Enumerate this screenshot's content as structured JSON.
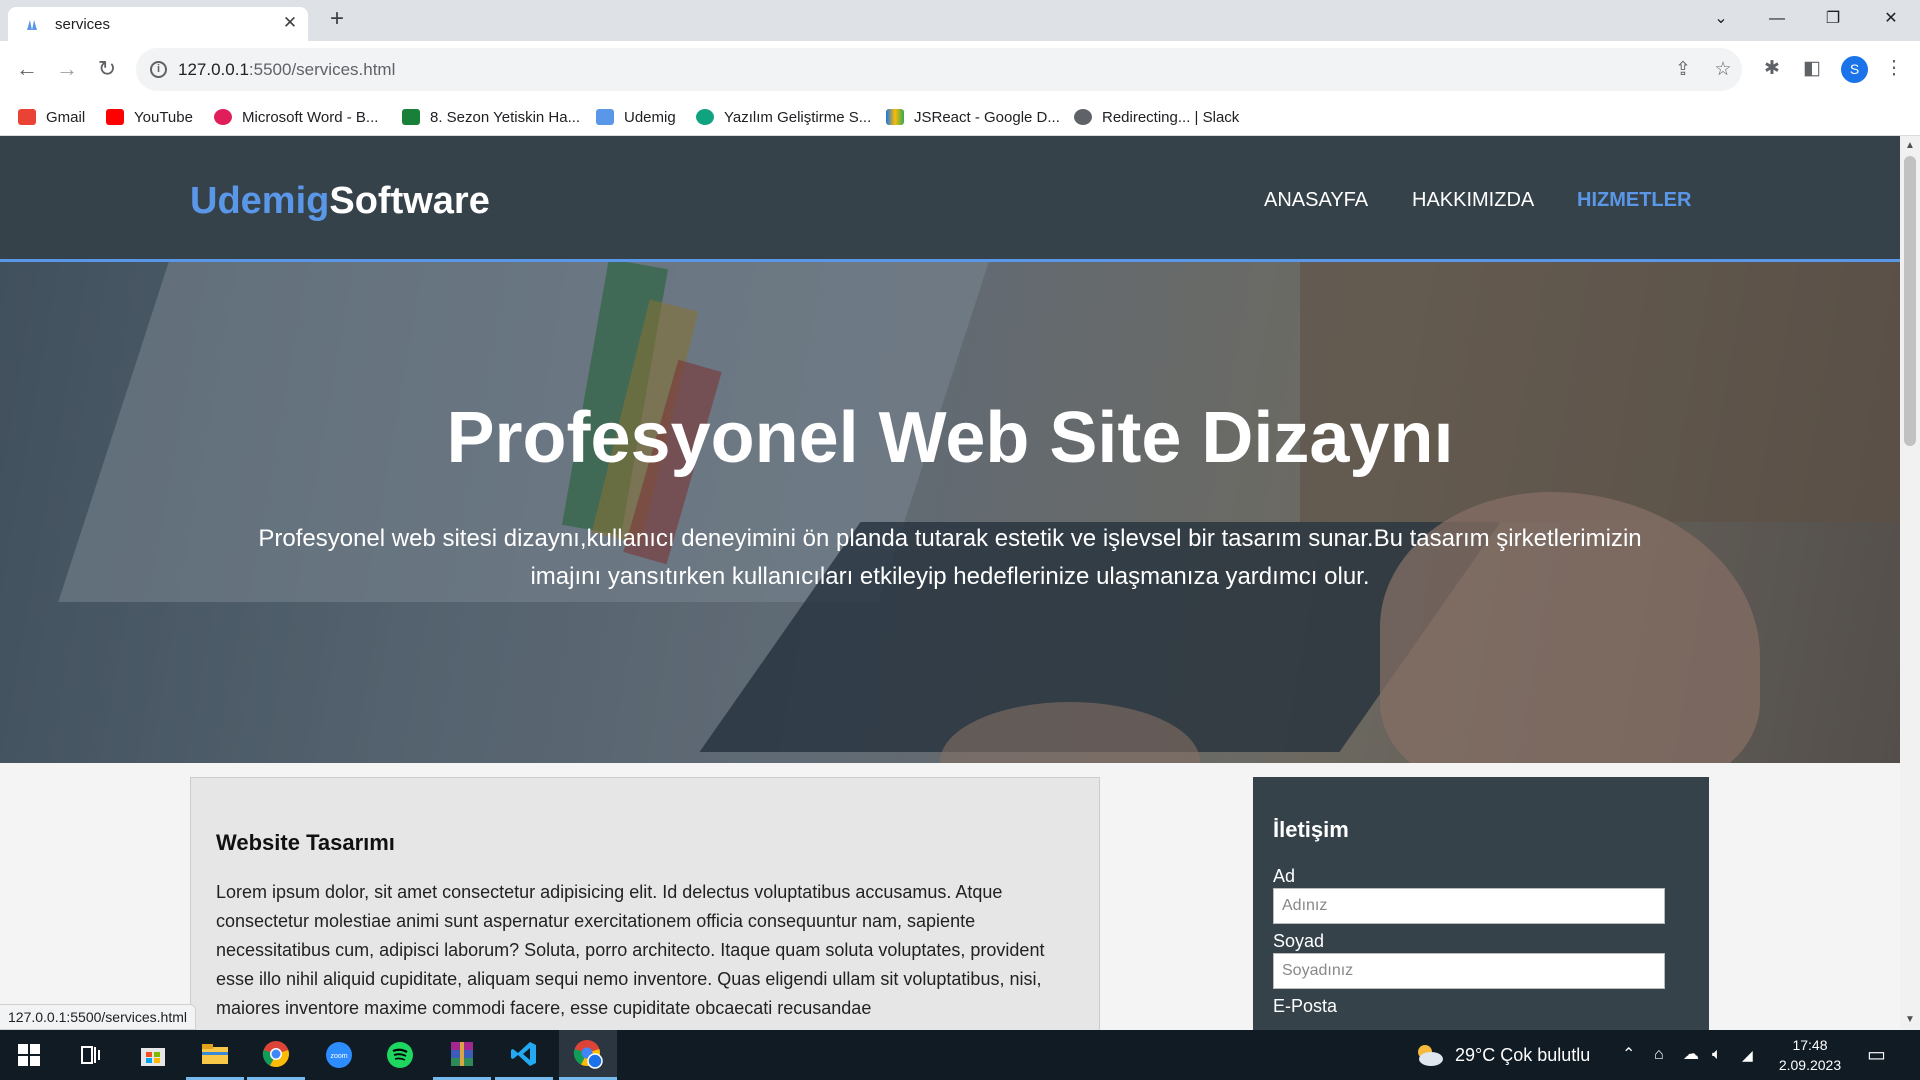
{
  "browser": {
    "tab_title": "services",
    "new_tab_symbol": "+",
    "url_host": "127.0.0.1",
    "url_rest": ":5500/services.html",
    "status_url": "127.0.0.1:5500/services.html",
    "bookmarks": [
      {
        "label": "Gmail",
        "icon": "gmail-icon",
        "color": "#ea4335"
      },
      {
        "label": "YouTube",
        "icon": "youtube-icon",
        "color": "#ff0000"
      },
      {
        "label": "Microsoft Word - B...",
        "icon": "word-icon",
        "color": "#e01e5a"
      },
      {
        "label": "8. Sezon Yetiskin Ha...",
        "icon": "classroom-icon",
        "color": "#188038"
      },
      {
        "label": "Udemig",
        "icon": "udemig-icon",
        "color": "#5b97e8"
      },
      {
        "label": "Yazılım Geliştirme S...",
        "icon": "chatgpt-icon",
        "color": "#10a37f"
      },
      {
        "label": "JSReact - Google D...",
        "icon": "drive-icon",
        "color": "#fbbc04"
      },
      {
        "label": "Redirecting... | Slack",
        "icon": "globe-icon",
        "color": "#5f6368"
      }
    ],
    "profile_initial": "S"
  },
  "site": {
    "logo_accent": "Udemig",
    "logo_rest": "Software",
    "nav": [
      {
        "label": "ANASAYFA",
        "active": false
      },
      {
        "label": "HAKKIMIZDA",
        "active": false
      },
      {
        "label": "HIZMETLER",
        "active": true
      }
    ],
    "hero": {
      "title": "Profesyonel Web Site Dizaynı",
      "text": "Profesyonel web sitesi dizaynı,kullanıcı deneyimini ön planda tutarak estetik ve işlevsel bir tasarım sunar.Bu tasarım şirketlerimizin imajını yansıtırken kullanıcıları etkileyip hedeflerinize ulaşmanıza yardımcı olur."
    },
    "article": {
      "title": "Website Tasarımı",
      "body": "Lorem ipsum dolor, sit amet consectetur adipisicing elit. Id delectus voluptatibus accusamus. Atque consectetur molestiae animi sunt aspernatur exercitationem officia consequuntur nam, sapiente necessitatibus cum, adipisci laborum? Soluta, porro architecto. Itaque quam soluta voluptates, provident esse illo nihil aliquid cupiditate, aliquam sequi nemo inventore. Quas eligendi ullam sit voluptatibus, nisi, maiores inventore maxime commodi facere, esse cupiditate obcaecati recusandae"
    },
    "contact": {
      "title": "İletişim",
      "name_label": "Ad",
      "name_placeholder": "Adınız",
      "surname_label": "Soyad",
      "surname_placeholder": "Soyadınız",
      "email_label": "E-Posta"
    },
    "colors": {
      "header_bg": "#35424a",
      "accent": "#5b97e8"
    }
  },
  "taskbar": {
    "weather": "29°C  Çok bulutlu",
    "time": "17:48",
    "date": "2.09.2023"
  }
}
